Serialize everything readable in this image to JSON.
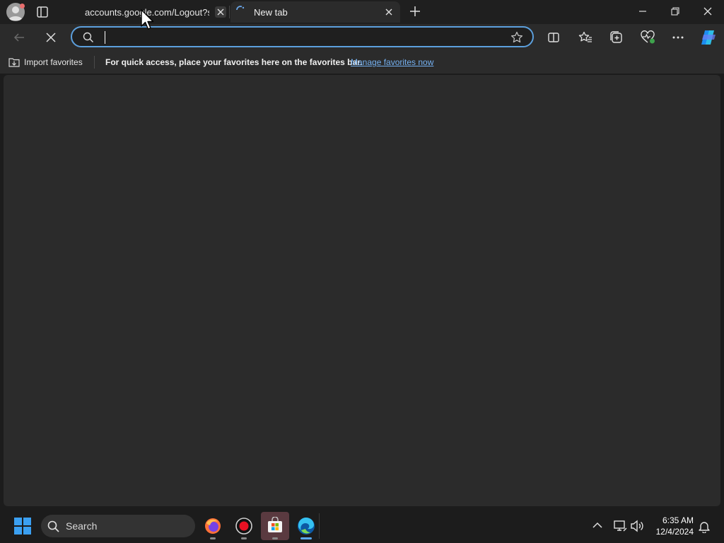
{
  "tabs": [
    {
      "title": "accounts.google.com/Logout?service=",
      "active": false
    },
    {
      "title": "New tab",
      "active": true
    }
  ],
  "omnibox": {
    "value": "",
    "placeholder": ""
  },
  "favorites_bar": {
    "import_label": "Import favorites",
    "hint": "For quick access, place your favorites here on the favorites bar.",
    "manage_link": "Manage favorites now"
  },
  "taskbar": {
    "search_label": "Search",
    "time": "6:35 AM",
    "date": "12/4/2024"
  },
  "colors": {
    "accent": "#5c9fdc",
    "link": "#74b0f0"
  }
}
